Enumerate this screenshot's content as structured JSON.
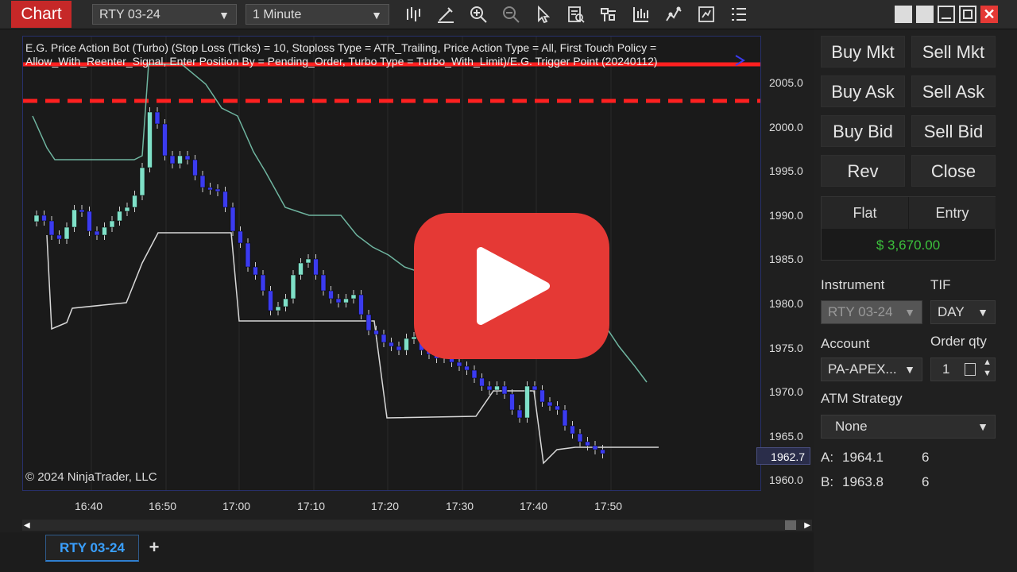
{
  "window": {
    "chart_tab": "Chart"
  },
  "toolbar": {
    "instrument": "RTY 03-24",
    "interval": "1 Minute",
    "icons": [
      "bar-type-icon",
      "draw-pencil-icon",
      "zoom-in-icon",
      "zoom-out-icon",
      "cursor-icon",
      "data-box-icon",
      "indicators-icon",
      "strategies-icon",
      "chart-style-icon",
      "templates-icon",
      "properties-list-icon"
    ]
  },
  "chart": {
    "strategy_label": "E.G. Price Action Bot (Turbo) (Stop Loss (Ticks) = 10, Stoploss Type = ATR_Trailing, Price Action Type = All, First Touch Policy = Allow_With_Reenter_Signal, Enter Position By = Pending_Order, Turbo Type = Turbo_With_Limit)/E.G. Trigger Point (20240112)",
    "copyright": "© 2024 NinjaTrader, LLC",
    "price_marker": "1962.7",
    "y_ticks": [
      "2005.0",
      "2000.0",
      "1995.0",
      "1990.0",
      "1985.0",
      "1980.0",
      "1975.0",
      "1970.0",
      "1965.0",
      "1960.0"
    ],
    "x_ticks": [
      "16:40",
      "16:50",
      "17:00",
      "17:10",
      "17:20",
      "17:30",
      "17:40",
      "17:50"
    ],
    "colors": {
      "up": "#7fe0c8",
      "down": "#3b3bf0",
      "stop": "#ff2020",
      "trail": "#6fb5a0",
      "line": "#d8d8d8"
    }
  },
  "tabs": {
    "active": "RTY 03-24",
    "add": "+"
  },
  "order_panel": {
    "buttons": {
      "buy_mkt": "Buy Mkt",
      "sell_mkt": "Sell Mkt",
      "buy_ask": "Buy Ask",
      "sell_ask": "Sell Ask",
      "buy_bid": "Buy Bid",
      "sell_bid": "Sell Bid",
      "rev": "Rev",
      "close": "Close"
    },
    "position": {
      "flat": "Flat",
      "entry": "Entry",
      "pnl": "$ 3,670.00"
    },
    "instrument_label": "Instrument",
    "instrument_value": "RTY 03-24",
    "tif_label": "TIF",
    "tif_value": "DAY",
    "account_label": "Account",
    "account_value": "PA-APEX...",
    "qty_label": "Order qty",
    "qty_value": "1",
    "atm_label": "ATM Strategy",
    "atm_value": "None",
    "ask_label": "A:",
    "ask_price": "1964.1",
    "ask_size": "6",
    "bid_label": "B:",
    "bid_price": "1963.8",
    "bid_size": "6"
  }
}
